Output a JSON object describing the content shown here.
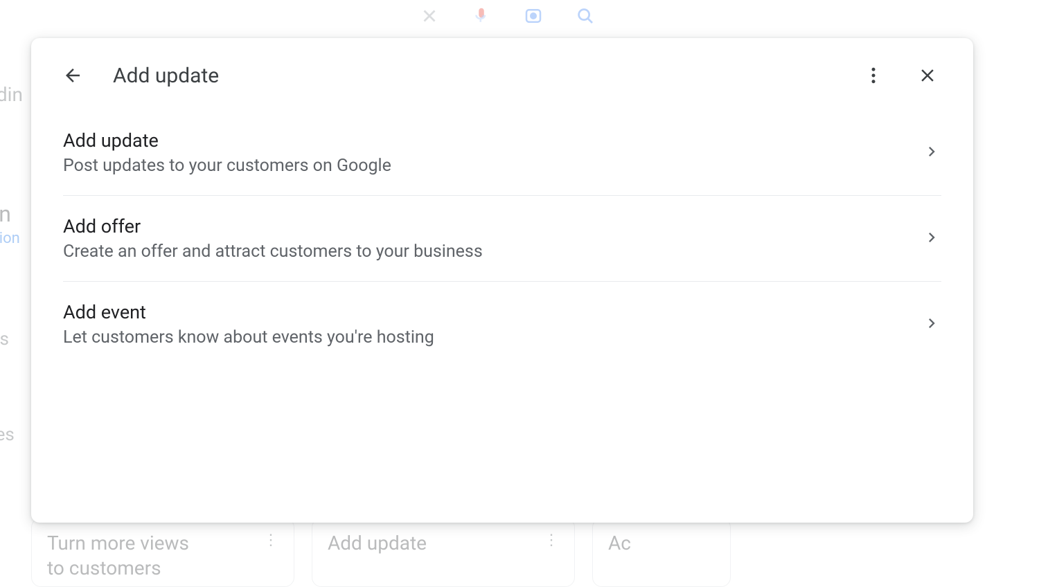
{
  "modal": {
    "title": "Add update",
    "options": [
      {
        "title": "Add update",
        "desc": "Post updates to your customers on Google"
      },
      {
        "title": "Add offer",
        "desc": "Create an offer and attract customers to your business"
      },
      {
        "title": "Add event",
        "desc": "Let customers know about events you're hosting"
      }
    ]
  },
  "background": {
    "side_fragments": {
      "edin": "edin",
      "on": "on",
      "ction": "ction",
      "ws": "ws",
      "ces": "ces"
    },
    "bottom_cards": [
      {
        "line1": "Turn more views",
        "line2": "to customers"
      },
      {
        "line1": "Add update",
        "line2": ""
      },
      {
        "line1": "Ac",
        "line2": ""
      }
    ]
  }
}
